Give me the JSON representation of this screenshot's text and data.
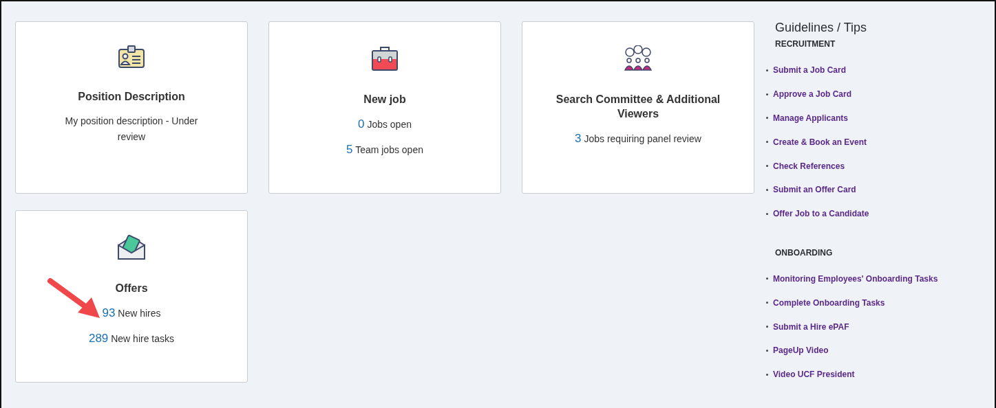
{
  "cards": [
    {
      "title": "Position Description",
      "lines": [
        {
          "kind": "text",
          "text": "My position description - Under review"
        }
      ]
    },
    {
      "title": "New job",
      "lines": [
        {
          "kind": "stat",
          "count": "0",
          "text": "Jobs open"
        },
        {
          "kind": "stat",
          "count": "5",
          "text": "Team jobs open"
        }
      ]
    },
    {
      "title": "Search Committee & Additional Viewers",
      "lines": [
        {
          "kind": "stat",
          "count": "3",
          "text": "Jobs requiring panel review"
        }
      ]
    },
    {
      "title": "Offers",
      "lines": [
        {
          "kind": "stat",
          "count": "93",
          "text": "New hires"
        },
        {
          "kind": "stat",
          "count": "289",
          "text": "New hire tasks"
        }
      ]
    }
  ],
  "guidelines": {
    "title": "Guidelines / Tips",
    "sections": [
      {
        "heading": "RECRUITMENT",
        "links": [
          "Submit a Job Card",
          "Approve a Job Card",
          "Manage Applicants",
          "Create & Book an Event",
          "Check References",
          "Submit an Offer Card",
          "Offer Job to a Candidate"
        ]
      },
      {
        "heading": "ONBOARDING",
        "links": [
          "Monitoring Employees' Onboarding Tasks",
          "Complete Onboarding Tasks",
          "Submit a Hire ePAF",
          "PageUp Video",
          "Video UCF President"
        ]
      }
    ]
  }
}
